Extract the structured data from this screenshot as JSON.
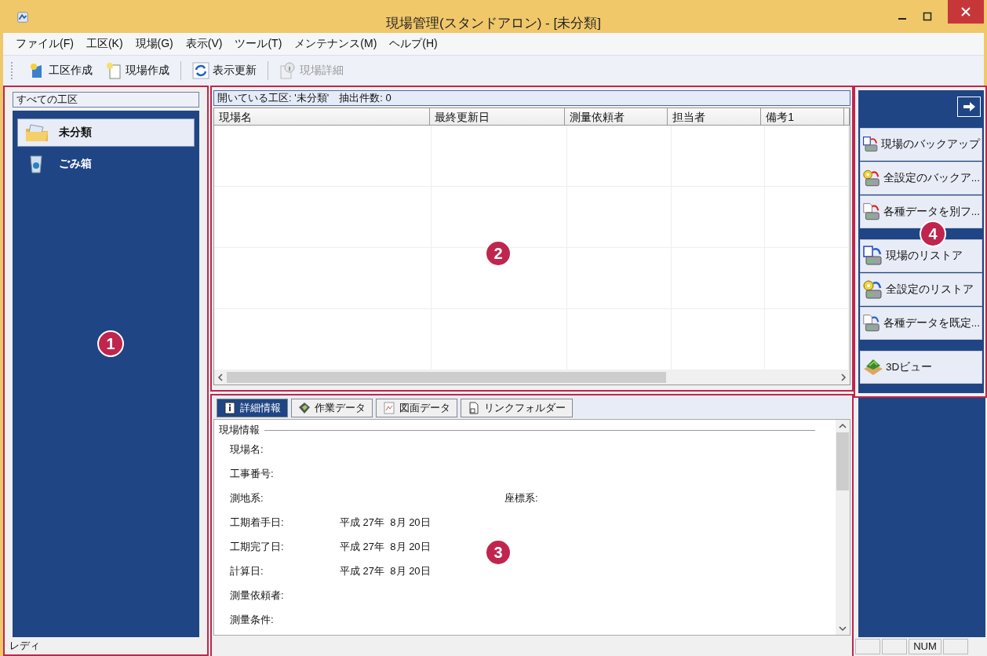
{
  "window": {
    "title": "現場管理(スタンドアロン) - [未分類]"
  },
  "menu": [
    "ファイル(F)",
    "工区(K)",
    "現場(G)",
    "表示(V)",
    "ツール(T)",
    "メンテナンス(M)",
    "ヘルプ(H)"
  ],
  "toolbar": [
    {
      "label": "工区作成",
      "kind": "area",
      "disabled": false
    },
    {
      "label": "現場作成",
      "kind": "site",
      "disabled": false
    },
    {
      "label": "表示更新",
      "kind": "refresh",
      "disabled": false
    },
    {
      "label": "現場詳細",
      "kind": "info",
      "disabled": true
    }
  ],
  "tree": {
    "header": "すべての工区",
    "items": [
      {
        "label": "未分類",
        "kind": "folder",
        "selected": true
      },
      {
        "label": "ごみ箱",
        "kind": "trash",
        "selected": false
      }
    ]
  },
  "site_list": {
    "info": "開いている工区: '未分類'　抽出件数: 0",
    "columns": [
      "現場名",
      "最終更新日",
      "測量依頼者",
      "担当者",
      "備考1"
    ]
  },
  "detail_tabs": [
    {
      "label": "詳細情報",
      "kind": "info",
      "selected": true
    },
    {
      "label": "作業データ",
      "kind": "work",
      "selected": false
    },
    {
      "label": "図面データ",
      "kind": "drawing",
      "selected": false
    },
    {
      "label": "リンクフォルダー",
      "kind": "link",
      "selected": false
    }
  ],
  "detail": {
    "section": "現場情報",
    "fields": [
      {
        "label": "現場名:"
      },
      {
        "label": "工事番号:"
      },
      {
        "label": "測地系:",
        "label_2": "座標系:"
      },
      {
        "label": "工期着手日:",
        "value": "平成 27年  8月 20日"
      },
      {
        "label": "工期完了日:",
        "value": "平成 27年  8月 20日"
      },
      {
        "label": "計算日:",
        "value": "平成 27年  8月 20日"
      },
      {
        "label": "測量依頼者:"
      },
      {
        "label": "測量条件:"
      }
    ]
  },
  "side_actions": [
    [
      {
        "label": "現場のバックアップ",
        "kind": "site_backup"
      },
      {
        "label": "全設定のバックア...",
        "kind": "settings_backup"
      },
      {
        "label": "各種データを別フ...",
        "kind": "data_backup"
      }
    ],
    [
      {
        "label": "現場のリストア",
        "kind": "site_restore"
      },
      {
        "label": "全設定のリストア",
        "kind": "settings_restore"
      },
      {
        "label": "各種データを既定...",
        "kind": "data_restore"
      }
    ],
    [
      {
        "label": "3Dビュー",
        "kind": "terrain"
      }
    ]
  ],
  "status_bar": {
    "text": "レディ",
    "indicators": [
      "NUM"
    ]
  },
  "callouts": [
    "1",
    "2",
    "3",
    "4"
  ]
}
